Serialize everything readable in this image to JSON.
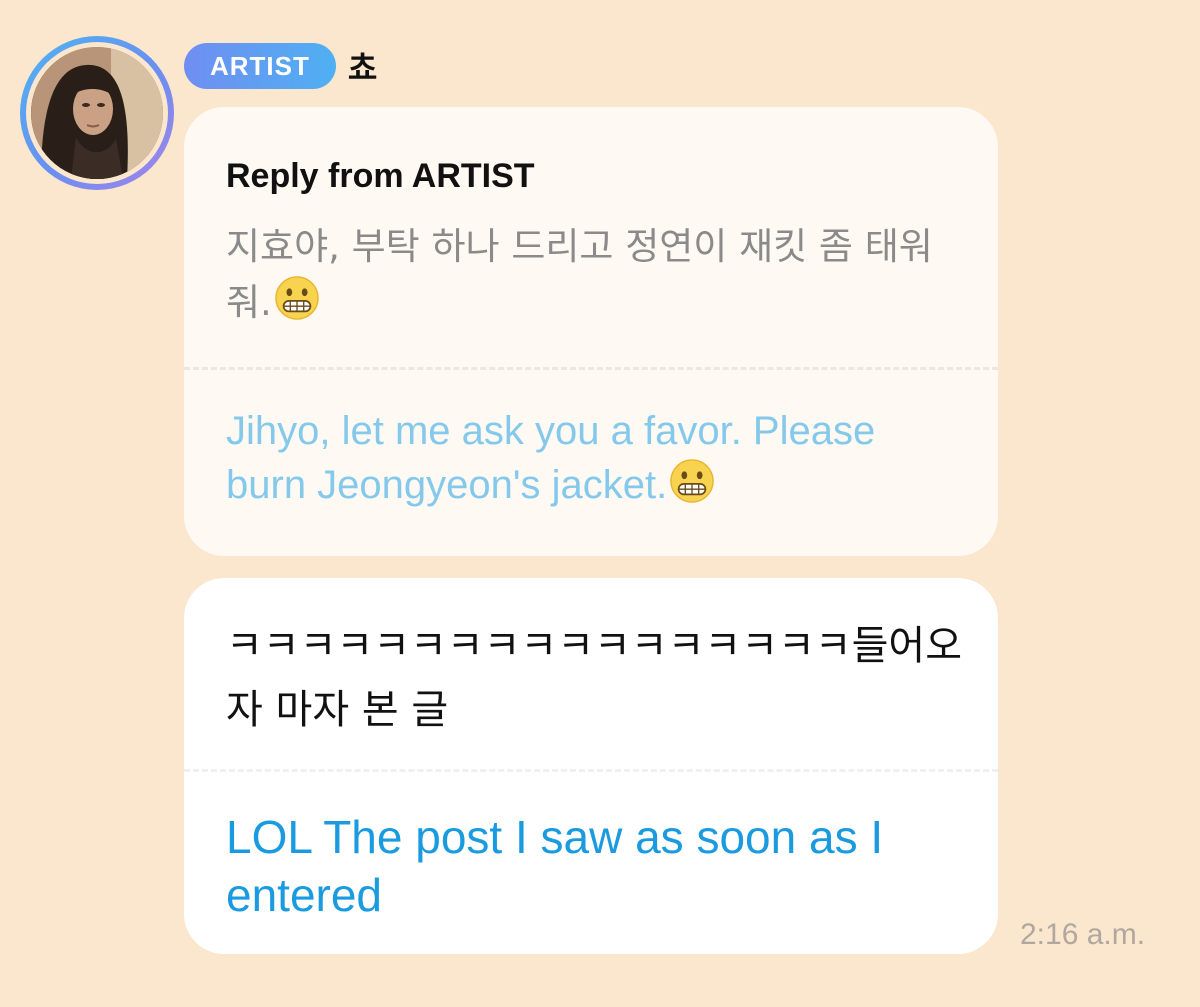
{
  "author": {
    "badge": "ARTIST",
    "name": "쵸"
  },
  "reply": {
    "title": "Reply from ARTIST",
    "original_text": "지효야, 부탁 하나 드리고 정연이 재킷 좀 태워줘.",
    "translated_text": "Jihyo, let me ask you a favor. Please burn Jeongyeon's jacket.",
    "emoji": "grimacing-face-emoji"
  },
  "message": {
    "original_text": "ㅋㅋㅋㅋㅋㅋㅋㅋㅋㅋㅋㅋㅋㅋㅋㅋㅋ들어오자 마자 본 글",
    "translated_text": "LOL The post I saw as soon as I entered",
    "timestamp": "2:16 a.m."
  },
  "icons": {
    "avatar": "artist-avatar-photo"
  },
  "colors": {
    "background": "#fbe6ce",
    "badge_gradient_start": "#6f8ef2",
    "badge_gradient_end": "#4fb0f2",
    "reply_translation": "#84c9ec",
    "message_translation": "#1a9be0"
  }
}
